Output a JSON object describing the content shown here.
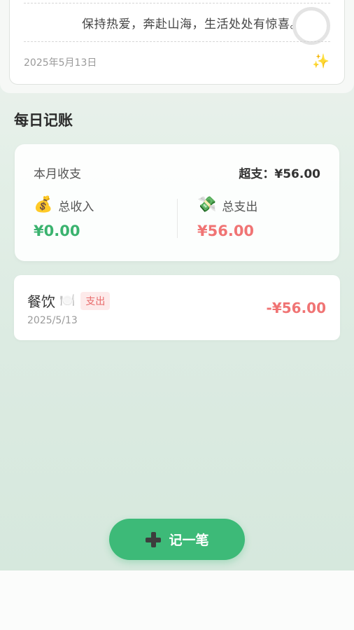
{
  "quote": {
    "text": "保持热爱，奔赴山海，生活处处有惊喜。",
    "date": "2025年5月13日",
    "sparkle": "✨"
  },
  "section_title": "每日记账",
  "summary": {
    "label": "本月收支",
    "over_text": "超支：¥56.00",
    "income": {
      "icon": "💰",
      "label": "总收入",
      "amount": "¥0.00"
    },
    "expense": {
      "icon": "💸",
      "label": "总支出",
      "amount": "¥56.00"
    }
  },
  "transactions": [
    {
      "category": "餐饮",
      "category_icon": "🍽️",
      "type_badge": "支出",
      "date": "2025/5/13",
      "amount": "-¥56.00"
    }
  ],
  "add_button": {
    "label": "记一笔"
  },
  "colors": {
    "accent": "#3dba78",
    "income": "#3bb36f",
    "expense": "#f07474"
  }
}
